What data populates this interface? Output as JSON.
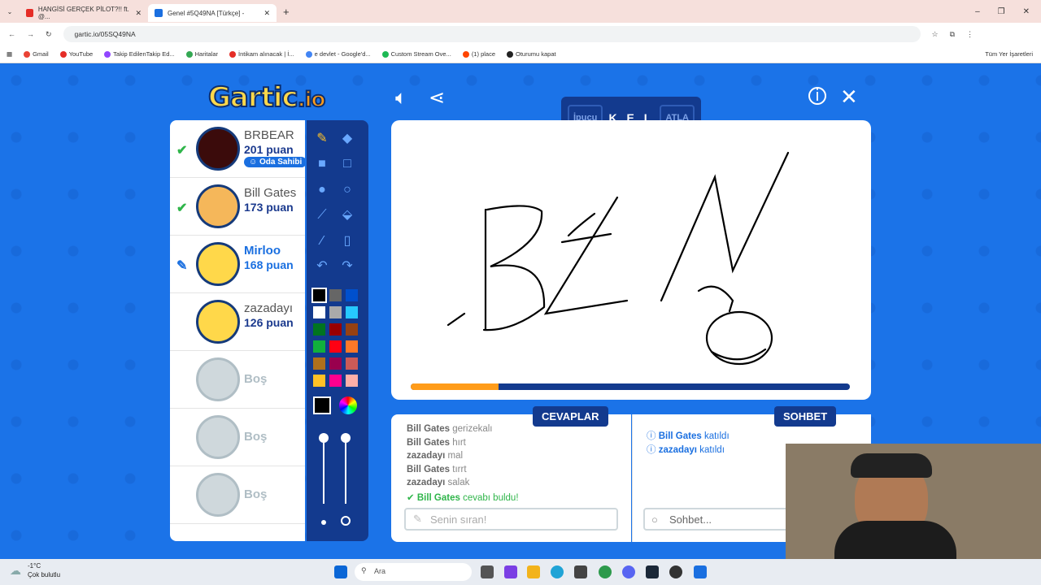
{
  "browser": {
    "tabs": [
      {
        "title": "HANGİSİ GERÇEK PİLOT?!! ft. @..."
      },
      {
        "title": "Genel #5Q49NA [Türkçe] -"
      }
    ],
    "url": "gartic.io/05SQ49NA",
    "bookmarks": [
      "Gmail",
      "YouTube",
      "Takip EdilenTakip Ed...",
      "Haritalar",
      "İntikam alınacak | İ...",
      "e devlet - Google'd...",
      "Custom Stream Ove...",
      "(1) place",
      "Oturumu kapat"
    ],
    "all_bookmarks": "Tüm Yer İşaretleri"
  },
  "game": {
    "logo": "Gartic",
    "logo_suffix": "io",
    "word": {
      "hint": "İpucu",
      "mask": "K E L",
      "skip": "ATLA"
    },
    "timer_progress": 0.2,
    "players": [
      {
        "name": "BRBEAR",
        "points": "201 puan",
        "owner": "Oda Sahibi",
        "status": "guessed"
      },
      {
        "name": "Bill Gates",
        "points": "173 puan",
        "status": "guessed"
      },
      {
        "name": "Mirloo",
        "points": "168 puan",
        "status": "drawing"
      },
      {
        "name": "zazadayı",
        "points": "126 puan",
        "status": "none"
      },
      {
        "name": "Boş"
      },
      {
        "name": "Boş"
      },
      {
        "name": "Boş"
      }
    ],
    "answers_tab": "CEVAPLAR",
    "chat_tab": "SOHBET",
    "answers": [
      {
        "user": "Bill Gates",
        "text": "gerizekalı"
      },
      {
        "user": "Bill Gates",
        "text": "hırt"
      },
      {
        "user": "zazadayı",
        "text": "mal"
      },
      {
        "user": "Bill Gates",
        "text": "tırrt"
      },
      {
        "user": "zazadayı",
        "text": "salak"
      },
      {
        "user": "Bill Gates",
        "text": "cevabı buldu!",
        "correct": true
      }
    ],
    "chat": [
      {
        "user": "Bill Gates",
        "text": "katıldı"
      },
      {
        "user": "zazadayı",
        "text": "katıldı"
      }
    ],
    "answer_placeholder": "Senin sıran!",
    "chat_placeholder": "Sohbet...",
    "colors": [
      "#000000",
      "#666666",
      "#0050cd",
      "#ffffff",
      "#aaaaaa",
      "#26c9ff",
      "#017420",
      "#990000",
      "#964112",
      "#11b03c",
      "#ff0013",
      "#ff7829",
      "#b0701c",
      "#99004e",
      "#cb5a57",
      "#ffc126",
      "#ff008f",
      "#feafa8"
    ]
  },
  "taskbar": {
    "weather_temp": "-1°C",
    "weather_text": "Çok bulutlu",
    "search": "Ara"
  }
}
